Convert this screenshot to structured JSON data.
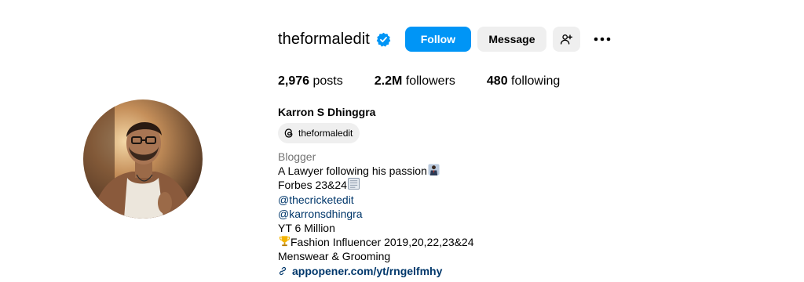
{
  "profile": {
    "username": "theformaledit",
    "verified": true,
    "full_name": "Karron S Dhinggra",
    "threads_handle": "theformaledit"
  },
  "actions": {
    "follow_label": "Follow",
    "message_label": "Message",
    "add_user_icon": "person-add-icon",
    "more_icon": "more-options-icon"
  },
  "stats": {
    "posts_count": "2,976",
    "posts_label": " posts",
    "followers_count": "2.2M",
    "followers_label": " followers",
    "following_count": "480",
    "following_label": " following"
  },
  "bio": {
    "category": "Blogger",
    "line1": "A Lawyer following his passion",
    "line2": "Forbes 23&24",
    "mention1": "@thecricketedit",
    "mention2": "@karronsdhingra",
    "line3": "YT 6 Million",
    "line4": " Fashion Influencer 2019,20,22,23&24",
    "line5": "Menswear & Grooming",
    "link": "appopener.com/yt/rngelfmhy"
  },
  "colors": {
    "accent": "#0095f6",
    "link": "#00376b",
    "secondary_text": "#737373",
    "button_bg": "#efefef"
  }
}
